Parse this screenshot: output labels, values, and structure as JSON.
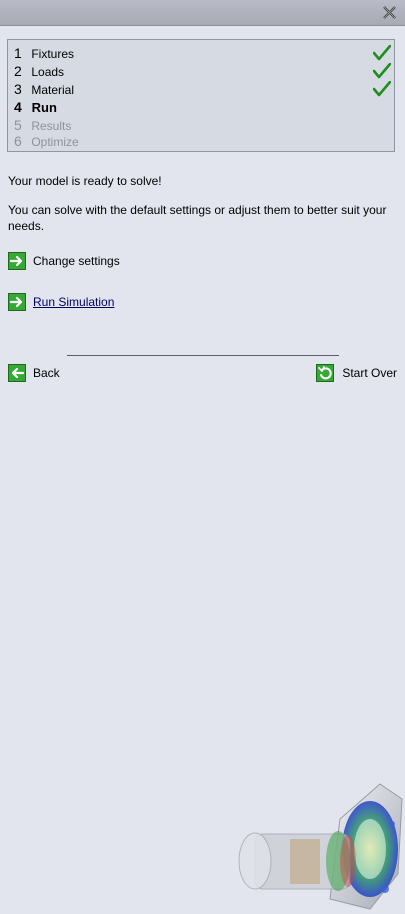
{
  "steps": [
    {
      "num": "1",
      "label": "Fixtures",
      "state": "done"
    },
    {
      "num": "2",
      "label": "Loads",
      "state": "done"
    },
    {
      "num": "3",
      "label": "Material",
      "state": "done"
    },
    {
      "num": "4",
      "label": "Run",
      "state": "current"
    },
    {
      "num": "5",
      "label": "Results",
      "state": "future"
    },
    {
      "num": "6",
      "label": "Optimize",
      "state": "future"
    }
  ],
  "messages": {
    "ready": "Your model is ready to solve!",
    "hint": "You can solve with the default settings or adjust them to better suit your needs."
  },
  "actions": {
    "change_settings": "Change settings",
    "run_simulation": "Run Simulation"
  },
  "nav": {
    "back": "Back",
    "start_over": "Start Over"
  },
  "icons": {
    "close": "close-icon",
    "check": "checkmark-icon",
    "arrow": "green-arrow-right-icon",
    "back": "green-arrow-left-icon",
    "restart": "green-restart-icon"
  },
  "colors": {
    "background": "#e3e5ee",
    "accent_green": "#2f9b2f",
    "disabled_text": "#8e9299"
  }
}
